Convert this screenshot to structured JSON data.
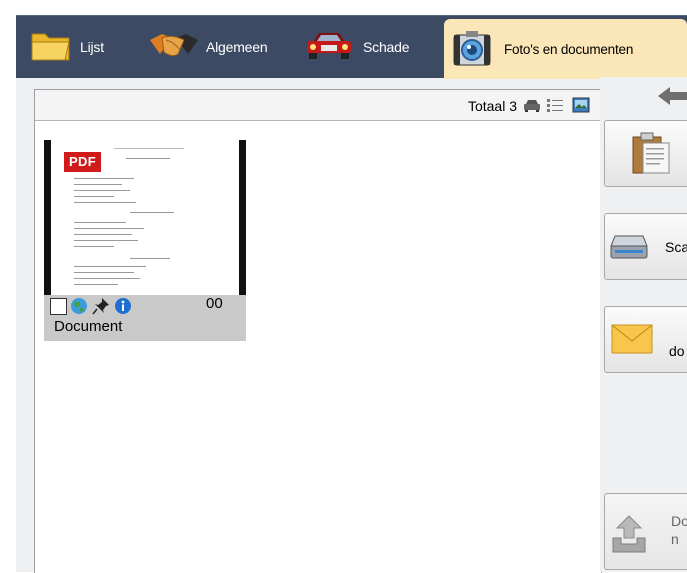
{
  "tabs": [
    {
      "label": "Lijst",
      "icon": "folder-icon"
    },
    {
      "label": "Algemeen",
      "icon": "handshake-icon"
    },
    {
      "label": "Schade",
      "icon": "car-icon"
    },
    {
      "label": "Foto's en documenten",
      "icon": "camera-icon",
      "active": true
    }
  ],
  "panel": {
    "total_label": "Totaal 3",
    "view_icons": [
      "car-view-icon",
      "list-view-icon",
      "image-view-icon"
    ]
  },
  "thumbnail": {
    "badge": "PDF",
    "count": "00",
    "label": "Document",
    "icons": [
      "checkbox",
      "globe-icon",
      "pin-icon",
      "info-icon"
    ]
  },
  "actions": [
    {
      "label": "",
      "icon": "clipboard-icon"
    },
    {
      "label": "Sca",
      "icon": "scanner-icon"
    },
    {
      "label": "do",
      "icon": "envelope-icon"
    },
    {
      "label": "Do\nn",
      "icon": "upload-icon"
    }
  ],
  "colors": {
    "toolbar_bg": "#3c4b63",
    "active_tab_bg": "#fbe6b8",
    "pdf_red": "#d11a1a"
  }
}
